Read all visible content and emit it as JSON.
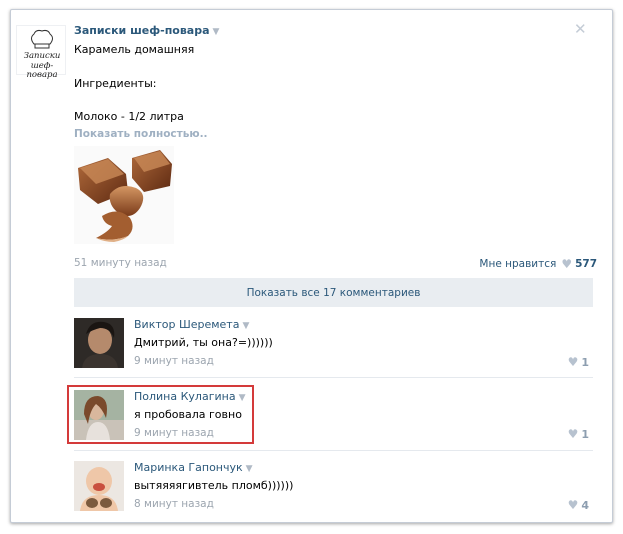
{
  "post": {
    "author": "Записки шеф-повара",
    "avatar_logo_line1": "Записки",
    "avatar_logo_line2": "шеф-повара",
    "title": "Карамель домашняя",
    "ingredients": "Ингредиенты:",
    "line": "Молоко - 1/2 литра",
    "show_more": "Показать полностью..",
    "time": "51 минуту назад",
    "like_label": "Мне нравится",
    "like_count": "577",
    "show_all_comments": "Показать все 17 комментариев"
  },
  "icons": {
    "close": "close-icon",
    "dropdown": "triangle-down-icon",
    "like": "heart-icon"
  },
  "comments": [
    {
      "name": "Виктор Шеремета",
      "text": "Дмитрий, ты она?=))))))",
      "time": "9 минут назад",
      "likes": "1"
    },
    {
      "name": "Полина Кулагина",
      "text": "я пробовала говно",
      "time": "9 минут назад",
      "likes": "1"
    },
    {
      "name": "Маринка Гапончук",
      "text": "вытяяяягивтель пломб))))))",
      "time": "8 минут назад",
      "likes": "4"
    }
  ],
  "colors": {
    "link": "#2b587a",
    "muted": "#9ca5af",
    "bar": "#e9edf1",
    "highlight": "#d43a3a"
  }
}
